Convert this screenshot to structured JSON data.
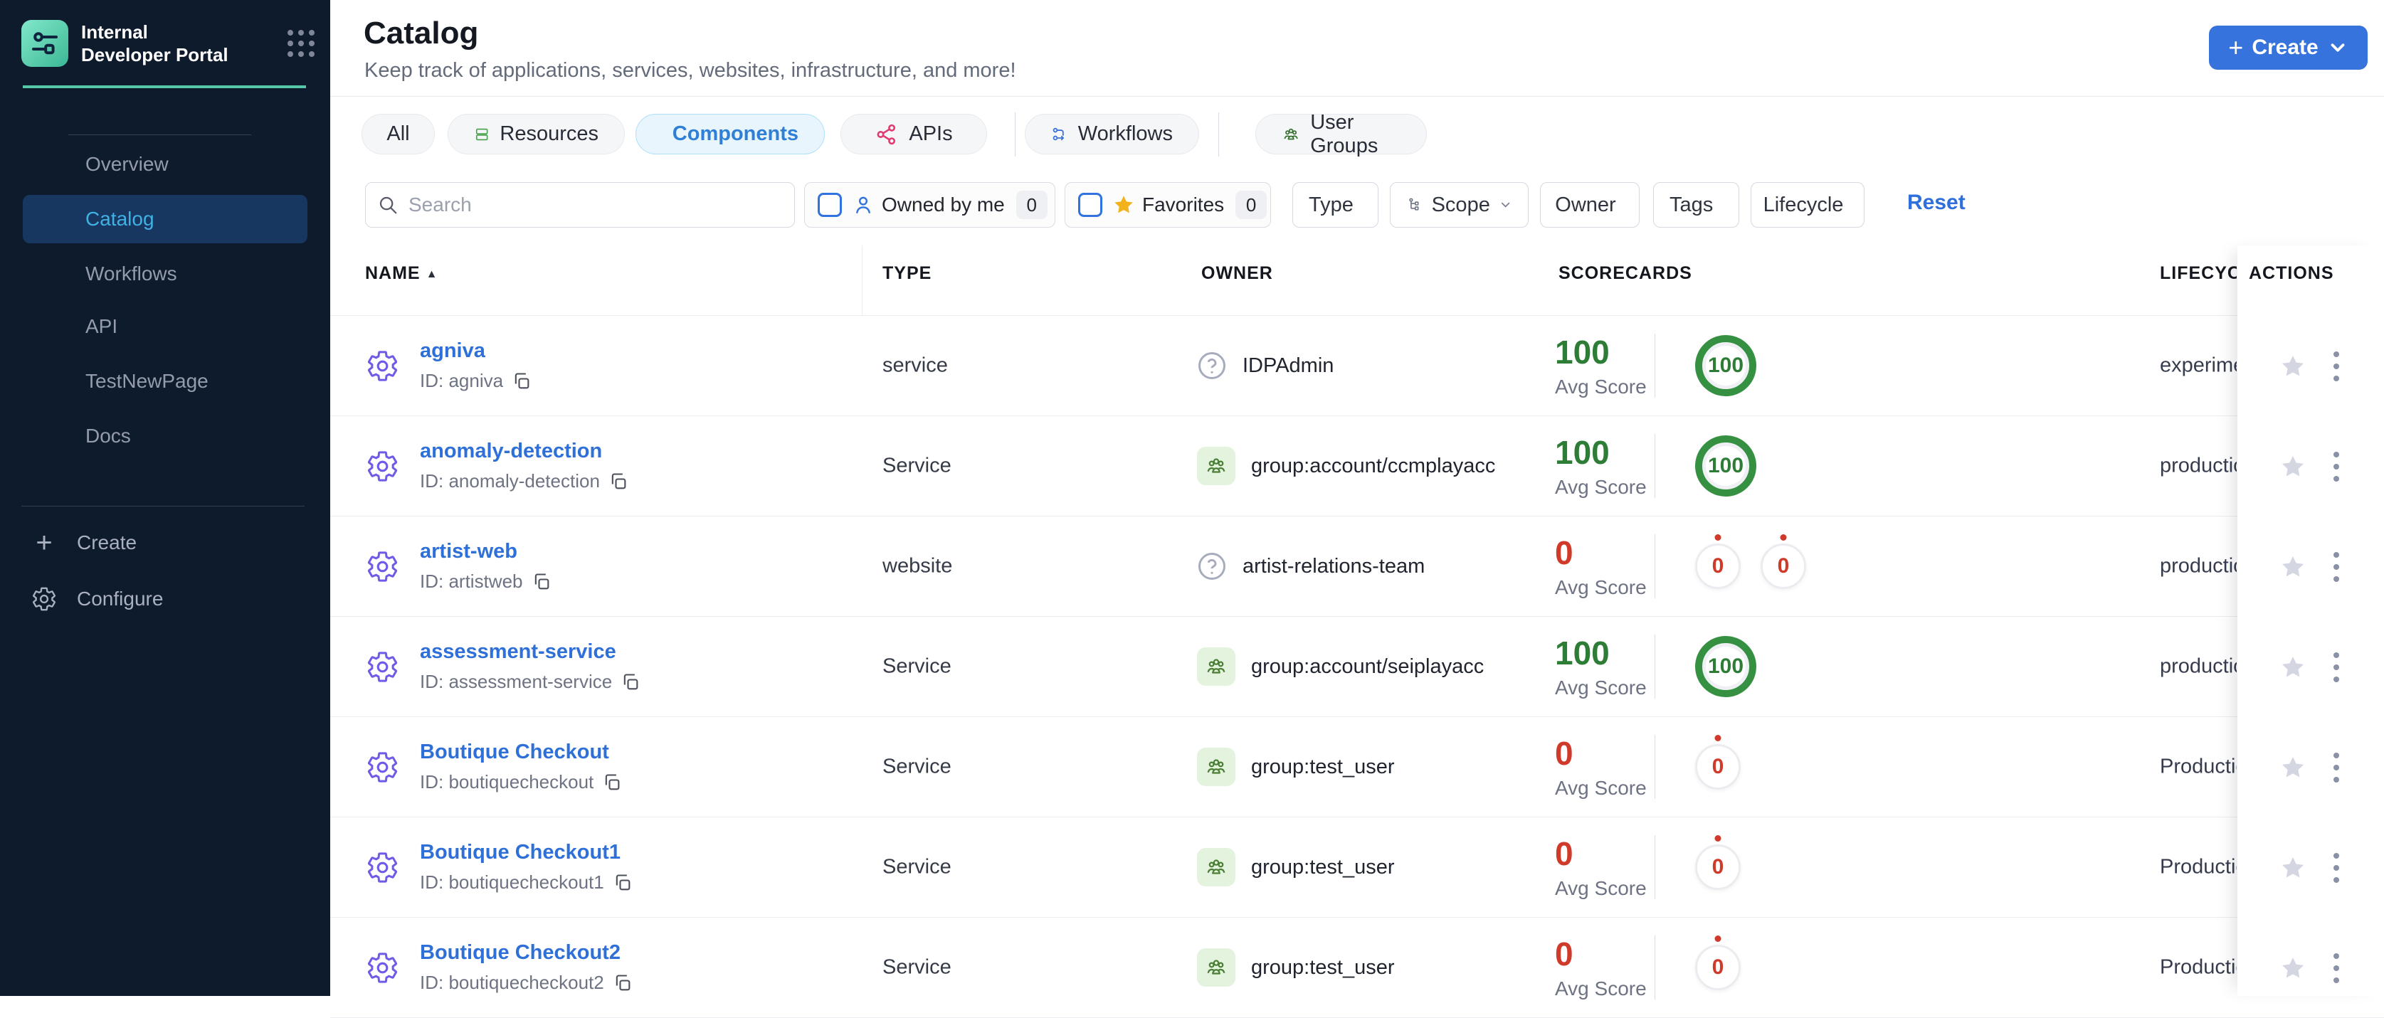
{
  "sidebar": {
    "logo_title": "Internal Developer Portal",
    "items": [
      {
        "label": "Overview",
        "active": false
      },
      {
        "label": "Catalog",
        "active": true
      },
      {
        "label": "Workflows",
        "active": false
      },
      {
        "label": "API",
        "active": false
      },
      {
        "label": "TestNewPage",
        "active": false
      },
      {
        "label": "Docs",
        "active": false
      }
    ],
    "footer_items": [
      {
        "label": "Create",
        "icon": "plus-icon"
      },
      {
        "label": "Configure",
        "icon": "gear-icon"
      }
    ]
  },
  "header": {
    "title": "Catalog",
    "subtitle": "Keep track of applications, services, websites, infrastructure, and more!",
    "create_button_label": "Create"
  },
  "tabs": [
    {
      "label": "All",
      "icon": "none",
      "selected": false
    },
    {
      "label": "Resources",
      "icon": "resources-stack-icon",
      "selected": false
    },
    {
      "label": "Components",
      "icon": "component-gear-icon",
      "selected": true
    },
    {
      "label": "APIs",
      "icon": "api-network-icon",
      "selected": false
    },
    {
      "label": "Workflows",
      "icon": "workflow-icon",
      "selected": false
    },
    {
      "label": "User Groups",
      "icon": "user-groups-icon",
      "selected": false
    }
  ],
  "filters": {
    "search_placeholder": "Search",
    "owned_by_me": {
      "label": "Owned by me",
      "count": "0",
      "checked": false
    },
    "favorites": {
      "label": "Favorites",
      "count": "0",
      "checked": false
    },
    "dropdowns": [
      {
        "label": "Type"
      },
      {
        "label": "Scope",
        "icon": "hierarchy-icon"
      },
      {
        "label": "Owner"
      },
      {
        "label": "Tags"
      },
      {
        "label": "Lifecycle"
      }
    ],
    "reset_label": "Reset"
  },
  "table": {
    "columns": {
      "name": "NAME",
      "type": "TYPE",
      "owner": "OWNER",
      "scorecards": "SCORECARDS",
      "lifecycle": "LIFECYCLE",
      "actions": "ACTIONS"
    },
    "sort_column": "NAME",
    "avg_score_label": "Avg Score",
    "rows": [
      {
        "name": "agniva",
        "id_label": "ID: agniva",
        "type": "service",
        "owner": "IDPAdmin",
        "owner_icon": "help-circle",
        "avg_score": "100",
        "score_color": "green",
        "rings": [
          {
            "value": "100",
            "variant": "green"
          }
        ],
        "lifecycle": "experimental"
      },
      {
        "name": "anomaly-detection",
        "id_label": "ID: anomaly-detection",
        "type": "Service",
        "owner": "group:account/ccmplayacc",
        "owner_icon": "user-group",
        "avg_score": "100",
        "score_color": "green",
        "rings": [
          {
            "value": "100",
            "variant": "green"
          }
        ],
        "lifecycle": "production"
      },
      {
        "name": "artist-web",
        "id_label": "ID: artistweb",
        "type": "website",
        "owner": "artist-relations-team",
        "owner_icon": "help-circle",
        "avg_score": "0",
        "score_color": "red",
        "rings": [
          {
            "value": "0",
            "variant": "zero"
          },
          {
            "value": "0",
            "variant": "zero"
          }
        ],
        "lifecycle": "production"
      },
      {
        "name": "assessment-service",
        "id_label": "ID: assessment-service",
        "type": "Service",
        "owner": "group:account/seiplayacc",
        "owner_icon": "user-group",
        "avg_score": "100",
        "score_color": "green",
        "rings": [
          {
            "value": "100",
            "variant": "green"
          }
        ],
        "lifecycle": "production"
      },
      {
        "name": "Boutique Checkout",
        "id_label": "ID: boutiquecheckout",
        "type": "Service",
        "owner": "group:test_user",
        "owner_icon": "user-group",
        "avg_score": "0",
        "score_color": "red",
        "rings": [
          {
            "value": "0",
            "variant": "zero"
          }
        ],
        "lifecycle": "Production"
      },
      {
        "name": "Boutique Checkout1",
        "id_label": "ID: boutiquecheckout1",
        "type": "Service",
        "owner": "group:test_user",
        "owner_icon": "user-group",
        "avg_score": "0",
        "score_color": "red",
        "rings": [
          {
            "value": "0",
            "variant": "zero"
          }
        ],
        "lifecycle": "Production"
      },
      {
        "name": "Boutique Checkout2",
        "id_label": "ID: boutiquecheckout2",
        "type": "Service",
        "owner": "group:test_user",
        "owner_icon": "user-group",
        "avg_score": "0",
        "score_color": "red",
        "rings": [
          {
            "value": "0",
            "variant": "zero"
          }
        ],
        "lifecycle": "Production"
      }
    ]
  },
  "colors": {
    "sidebar_bg": "#0e1b2d",
    "accent_teal": "#57c8a7",
    "primary_blue": "#3673dc",
    "link_blue": "#2e6fd8",
    "selected_tab_text": "#2e7fd5",
    "selected_tab_bg": "#e8f5fd",
    "score_green": "#2e7d36",
    "score_red": "#cf3a2a",
    "component_purple": "#6e5be8",
    "favorite_yellow": "#f2b21c"
  }
}
